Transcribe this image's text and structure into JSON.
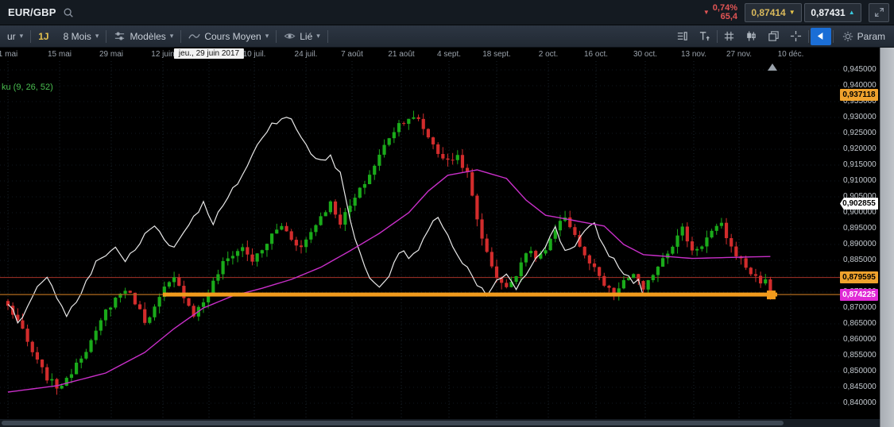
{
  "topbar": {
    "instrument": "EUR/GBP",
    "change_pct": "0,74%",
    "change_points": "65,4",
    "sell_price": "0,87414",
    "buy_price": "0,87431"
  },
  "toolbar": {
    "cut_dropdown_label": "ur",
    "timeframe_label": "1J",
    "range_label": "8 Mois",
    "models_label": "Modèles",
    "moving_average_label": "Cours Moyen",
    "linked_label": "Lié",
    "settings_label": "Param"
  },
  "chart_data": {
    "type": "candlestick",
    "symbol": "EUR/GBP",
    "timeframe": "1J",
    "visible_range": "8 Mois",
    "indicator_label": "ku (9, 26, 52)",
    "crosshair_date": "jeu., 29 juin 2017",
    "x_ticks": [
      "1 mai",
      "15 mai",
      "29 mai",
      "12 juin",
      "10 juil.",
      "24 juil.",
      "7 août",
      "21 août",
      "4 sept.",
      "18 sept.",
      "2 oct.",
      "16 oct.",
      "30 oct.",
      "13 nov.",
      "27 nov.",
      "10 déc."
    ],
    "y_ticks": [
      "0,945000",
      "0,940000",
      "0,935000",
      "0,930000",
      "0,925000",
      "0,920000",
      "0,915000",
      "0,910000",
      "0,905000",
      "0,900000",
      "0,895000",
      "0,890000",
      "0,885000",
      "0,880000",
      "0,875000",
      "0,870000",
      "0,865000",
      "0,860000",
      "0,855000",
      "0,850000",
      "0,845000",
      "0,840000"
    ],
    "ylim": [
      0.836,
      0.949
    ],
    "bars": 157,
    "chikou_shift": 26,
    "close_keypoints": [
      [
        0,
        0.8705
      ],
      [
        2,
        0.866
      ],
      [
        4,
        0.859
      ],
      [
        6,
        0.853
      ],
      [
        8,
        0.848
      ],
      [
        10,
        0.8452
      ],
      [
        12,
        0.847
      ],
      [
        14,
        0.853
      ],
      [
        16,
        0.857
      ],
      [
        18,
        0.862
      ],
      [
        20,
        0.869
      ],
      [
        22,
        0.873
      ],
      [
        24,
        0.876
      ],
      [
        26,
        0.872
      ],
      [
        28,
        0.866
      ],
      [
        30,
        0.87
      ],
      [
        32,
        0.876
      ],
      [
        34,
        0.879
      ],
      [
        36,
        0.874
      ],
      [
        38,
        0.868
      ],
      [
        40,
        0.872
      ],
      [
        42,
        0.878
      ],
      [
        44,
        0.884
      ],
      [
        46,
        0.887
      ],
      [
        48,
        0.889
      ],
      [
        50,
        0.885
      ],
      [
        52,
        0.888
      ],
      [
        54,
        0.893
      ],
      [
        56,
        0.896
      ],
      [
        58,
        0.892
      ],
      [
        60,
        0.889
      ],
      [
        62,
        0.894
      ],
      [
        64,
        0.899
      ],
      [
        66,
        0.903
      ],
      [
        68,
        0.897
      ],
      [
        70,
        0.902
      ],
      [
        72,
        0.907
      ],
      [
        74,
        0.912
      ],
      [
        76,
        0.918
      ],
      [
        78,
        0.924
      ],
      [
        80,
        0.928
      ],
      [
        82,
        0.93
      ],
      [
        84,
        0.929
      ],
      [
        86,
        0.924
      ],
      [
        88,
        0.919
      ],
      [
        90,
        0.916
      ],
      [
        92,
        0.918
      ],
      [
        94,
        0.912
      ],
      [
        96,
        0.898
      ],
      [
        98,
        0.887
      ],
      [
        100,
        0.88
      ],
      [
        102,
        0.876
      ],
      [
        104,
        0.881
      ],
      [
        106,
        0.888
      ],
      [
        108,
        0.886
      ],
      [
        110,
        0.888
      ],
      [
        112,
        0.894
      ],
      [
        114,
        0.899
      ],
      [
        116,
        0.893
      ],
      [
        118,
        0.886
      ],
      [
        120,
        0.882
      ],
      [
        122,
        0.877
      ],
      [
        124,
        0.874
      ],
      [
        126,
        0.878
      ],
      [
        128,
        0.881
      ],
      [
        130,
        0.875
      ],
      [
        132,
        0.881
      ],
      [
        134,
        0.886
      ],
      [
        136,
        0.89
      ],
      [
        138,
        0.895
      ],
      [
        140,
        0.888
      ],
      [
        142,
        0.89
      ],
      [
        144,
        0.894
      ],
      [
        146,
        0.896
      ],
      [
        148,
        0.889
      ],
      [
        150,
        0.885
      ],
      [
        152,
        0.881
      ],
      [
        154,
        0.8785
      ],
      [
        156,
        0.874
      ]
    ],
    "ma_keypoints": [
      [
        0,
        0.8435
      ],
      [
        10,
        0.8455
      ],
      [
        20,
        0.8495
      ],
      [
        28,
        0.856
      ],
      [
        34,
        0.8635
      ],
      [
        40,
        0.87
      ],
      [
        46,
        0.8738
      ],
      [
        52,
        0.8762
      ],
      [
        58,
        0.879
      ],
      [
        64,
        0.8828
      ],
      [
        70,
        0.888
      ],
      [
        76,
        0.8935
      ],
      [
        82,
        0.9
      ],
      [
        86,
        0.9068
      ],
      [
        90,
        0.9118
      ],
      [
        96,
        0.9135
      ],
      [
        102,
        0.9108
      ],
      [
        106,
        0.904
      ],
      [
        110,
        0.8992
      ],
      [
        116,
        0.8975
      ],
      [
        122,
        0.8958
      ],
      [
        126,
        0.89
      ],
      [
        130,
        0.8868
      ],
      [
        140,
        0.8856
      ],
      [
        150,
        0.886
      ],
      [
        156,
        0.8862
      ]
    ],
    "forced_last_closes": [
      0.879,
      0.8738
    ],
    "levels": {
      "average_price_line": {
        "value": 0.879595,
        "color": "#a83228"
      },
      "support_band": {
        "value": 0.874225,
        "color": "#f29b1d",
        "thin_color": "#b06a1e"
      }
    },
    "price_tags": [
      {
        "label": "0,937118",
        "value": 0.937118,
        "bg": "#efa22d",
        "fg": "#000000",
        "pointed": false
      },
      {
        "label": "0,902855",
        "value": 0.902855,
        "bg": "#ffffff",
        "fg": "#000000",
        "pointed": true
      },
      {
        "label": "0,879595",
        "value": 0.879595,
        "bg": "#efa22d",
        "fg": "#000000",
        "pointed": false
      },
      {
        "label": "0,874225",
        "value": 0.874225,
        "bg": "#e02ad6",
        "fg": "#ffffff",
        "pointed": false
      }
    ],
    "colors": {
      "up": "#1aaa1a",
      "down": "#d22c2c",
      "chikou_line": "#e8e8e8",
      "ma_line": "#c92fc9",
      "background": "#000000"
    }
  }
}
